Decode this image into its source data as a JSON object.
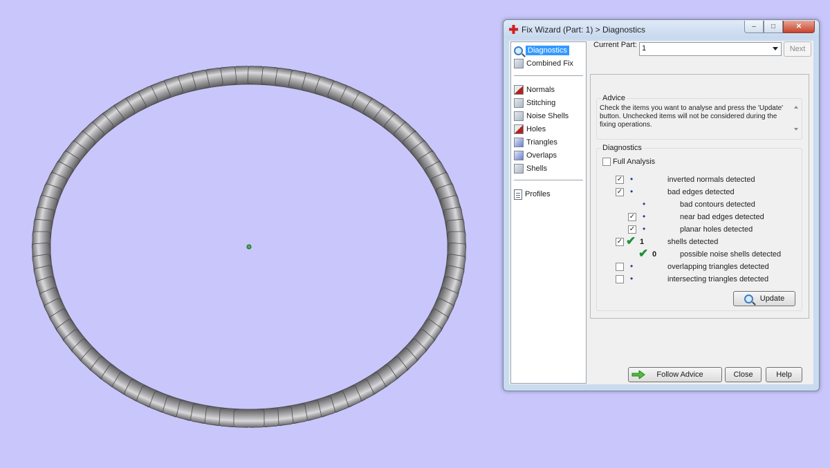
{
  "window": {
    "title": "Fix Wizard (Part: 1) > Diagnostics",
    "minimize_glyph": "–",
    "maximize_glyph": "□",
    "close_glyph": "✕"
  },
  "sidebar": {
    "items": [
      {
        "label": "Diagnostics",
        "icon": "magnifier-icon"
      },
      {
        "label": "Combined Fix",
        "icon": "cube-icon"
      },
      {
        "label": "Normals",
        "icon": "normals-cube-icon"
      },
      {
        "label": "Stitching",
        "icon": "stitching-cube-icon"
      },
      {
        "label": "Noise Shells",
        "icon": "noise-shells-icon"
      },
      {
        "label": "Holes",
        "icon": "holes-cube-icon"
      },
      {
        "label": "Triangles",
        "icon": "triangles-cube-icon"
      },
      {
        "label": "Overlaps",
        "icon": "overlaps-cube-icon"
      },
      {
        "label": "Shells",
        "icon": "shells-cube-icon"
      },
      {
        "label": "Profiles",
        "icon": "profiles-icon"
      }
    ]
  },
  "header": {
    "current_part_label": "Current Part:",
    "current_part_value": "1",
    "next_label": "Next"
  },
  "advice": {
    "title": "Advice",
    "text": "Check the items you want to analyse and press the 'Update' button. Unchecked items will not be considered during the fixing operations."
  },
  "diagnostics": {
    "title": "Diagnostics",
    "full_analysis_label": "Full Analysis",
    "rows": [
      {
        "label": "inverted normals detected",
        "checked": true,
        "indicator": "•"
      },
      {
        "label": "bad edges detected",
        "checked": true,
        "indicator": "•"
      },
      {
        "label": "bad contours detected",
        "indicator": "•"
      },
      {
        "label": "near bad edges detected",
        "checked": true,
        "indicator": "•"
      },
      {
        "label": "planar holes detected",
        "checked": true,
        "indicator": "•"
      },
      {
        "label": "shells detected",
        "checked": true,
        "count": "1"
      },
      {
        "label": "possible noise shells detected",
        "count": "0"
      },
      {
        "label": "overlapping triangles detected",
        "checked": false,
        "indicator": "•"
      },
      {
        "label": "intersecting triangles detected",
        "checked": false,
        "indicator": "•"
      }
    ],
    "update_label": "Update",
    "check_glyph": "✓",
    "tick_glyph": "✔"
  },
  "footer": {
    "follow_advice_label": "Follow Advice",
    "close_label": "Close",
    "help_label": "Help"
  },
  "colors": {
    "viewport_bg": "#c8c6fa",
    "selection": "#3399ff",
    "ok_green": "#1e8f3a"
  }
}
